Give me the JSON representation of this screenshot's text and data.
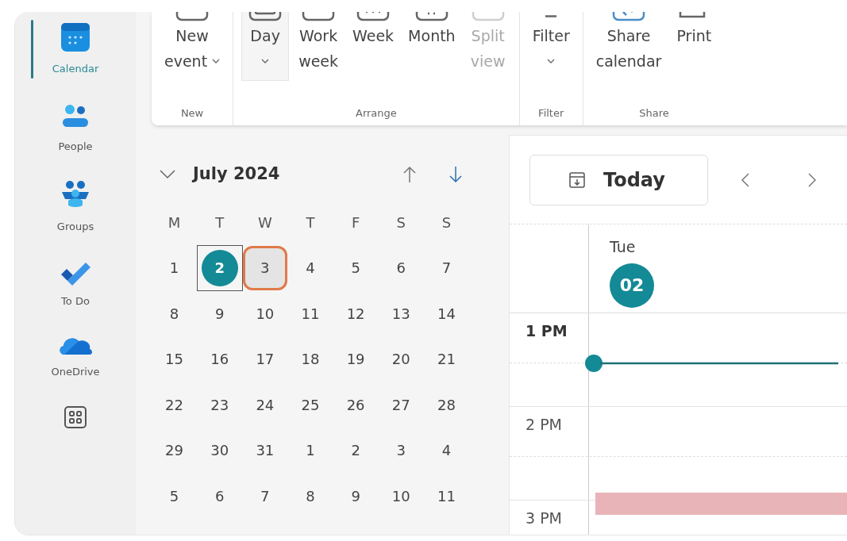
{
  "nav": [
    {
      "label": "Calendar",
      "kind": "calendar",
      "selected": true
    },
    {
      "label": "People",
      "kind": "people",
      "selected": false
    },
    {
      "label": "Groups",
      "kind": "groups",
      "selected": false
    },
    {
      "label": "To Do",
      "kind": "todo",
      "selected": false
    },
    {
      "label": "OneDrive",
      "kind": "cloud",
      "selected": false
    },
    {
      "kind": "apps",
      "selected": false
    }
  ],
  "ribbon": [
    {
      "group": "New",
      "buttons": [
        {
          "lines": [
            "New",
            "event"
          ],
          "dropdown": true,
          "selected": false,
          "disabled": false,
          "kind": "box"
        }
      ]
    },
    {
      "group": "Arrange",
      "buttons": [
        {
          "lines": [
            "Day"
          ],
          "dropdown": true,
          "selected": true,
          "disabled": false,
          "kind": "day"
        },
        {
          "lines": [
            "Work",
            "week"
          ],
          "dropdown": false,
          "selected": false,
          "disabled": false,
          "kind": "box"
        },
        {
          "lines": [
            "Week"
          ],
          "dropdown": false,
          "selected": false,
          "disabled": false,
          "kind": "week"
        },
        {
          "lines": [
            "Month"
          ],
          "dropdown": false,
          "selected": false,
          "disabled": false,
          "kind": "month"
        },
        {
          "lines": [
            "Split",
            "view"
          ],
          "dropdown": false,
          "selected": false,
          "disabled": true,
          "kind": "split"
        }
      ]
    },
    {
      "group": "Filter",
      "buttons": [
        {
          "lines": [
            "Filter"
          ],
          "dropdown": true,
          "selected": false,
          "disabled": false,
          "kind": "filter"
        }
      ]
    },
    {
      "group": "Share",
      "buttons": [
        {
          "lines": [
            "Share",
            "calendar"
          ],
          "dropdown": false,
          "selected": false,
          "disabled": false,
          "kind": "share"
        },
        {
          "lines": [
            "Print"
          ],
          "dropdown": false,
          "selected": false,
          "disabled": false,
          "kind": "print"
        }
      ]
    }
  ],
  "mini_calendar": {
    "month": "July 2024",
    "weekdays": [
      "M",
      "T",
      "W",
      "T",
      "F",
      "S",
      "S"
    ],
    "weeks": [
      [
        {
          "label": "1",
          "today": false,
          "selected": false,
          "outlined": false
        },
        {
          "label": "2",
          "today": true,
          "selected": true,
          "outlined": false
        },
        {
          "label": "3",
          "today": false,
          "selected": false,
          "outlined": true
        },
        {
          "label": "4",
          "today": false,
          "selected": false,
          "outlined": false
        },
        {
          "label": "5",
          "today": false,
          "selected": false,
          "outlined": false
        },
        {
          "label": "6",
          "today": false,
          "selected": false,
          "outlined": false
        },
        {
          "label": "7",
          "today": false,
          "selected": false,
          "outlined": false
        }
      ],
      [
        {
          "label": "8",
          "today": false,
          "selected": false,
          "outlined": false
        },
        {
          "label": "9",
          "today": false,
          "selected": false,
          "outlined": false
        },
        {
          "label": "10",
          "today": false,
          "selected": false,
          "outlined": false
        },
        {
          "label": "11",
          "today": false,
          "selected": false,
          "outlined": false
        },
        {
          "label": "12",
          "today": false,
          "selected": false,
          "outlined": false
        },
        {
          "label": "13",
          "today": false,
          "selected": false,
          "outlined": false
        },
        {
          "label": "14",
          "today": false,
          "selected": false,
          "outlined": false
        }
      ],
      [
        {
          "label": "15",
          "today": false,
          "selected": false,
          "outlined": false
        },
        {
          "label": "16",
          "today": false,
          "selected": false,
          "outlined": false
        },
        {
          "label": "17",
          "today": false,
          "selected": false,
          "outlined": false
        },
        {
          "label": "18",
          "today": false,
          "selected": false,
          "outlined": false
        },
        {
          "label": "19",
          "today": false,
          "selected": false,
          "outlined": false
        },
        {
          "label": "20",
          "today": false,
          "selected": false,
          "outlined": false
        },
        {
          "label": "21",
          "today": false,
          "selected": false,
          "outlined": false
        }
      ],
      [
        {
          "label": "22",
          "today": false,
          "selected": false,
          "outlined": false
        },
        {
          "label": "23",
          "today": false,
          "selected": false,
          "outlined": false
        },
        {
          "label": "24",
          "today": false,
          "selected": false,
          "outlined": false
        },
        {
          "label": "25",
          "today": false,
          "selected": false,
          "outlined": false
        },
        {
          "label": "26",
          "today": false,
          "selected": false,
          "outlined": false
        },
        {
          "label": "27",
          "today": false,
          "selected": false,
          "outlined": false
        },
        {
          "label": "28",
          "today": false,
          "selected": false,
          "outlined": false
        }
      ],
      [
        {
          "label": "29",
          "today": false,
          "selected": false,
          "outlined": false
        },
        {
          "label": "30",
          "today": false,
          "selected": false,
          "outlined": false
        },
        {
          "label": "31",
          "today": false,
          "selected": false,
          "outlined": false
        },
        {
          "label": "1",
          "today": false,
          "selected": false,
          "outlined": false
        },
        {
          "label": "2",
          "today": false,
          "selected": false,
          "outlined": false
        },
        {
          "label": "3",
          "today": false,
          "selected": false,
          "outlined": false
        },
        {
          "label": "4",
          "today": false,
          "selected": false,
          "outlined": false
        }
      ],
      [
        {
          "label": "5",
          "today": false,
          "selected": false,
          "outlined": false
        },
        {
          "label": "6",
          "today": false,
          "selected": false,
          "outlined": false
        },
        {
          "label": "7",
          "today": false,
          "selected": false,
          "outlined": false
        },
        {
          "label": "8",
          "today": false,
          "selected": false,
          "outlined": false
        },
        {
          "label": "9",
          "today": false,
          "selected": false,
          "outlined": false
        },
        {
          "label": "10",
          "today": false,
          "selected": false,
          "outlined": false
        },
        {
          "label": "11",
          "today": false,
          "selected": false,
          "outlined": false
        }
      ]
    ]
  },
  "day_view": {
    "today_button": "Today",
    "day_name": "Tue",
    "day_number": "02",
    "hours": [
      "1 PM",
      "2 PM",
      "3 PM"
    ]
  }
}
